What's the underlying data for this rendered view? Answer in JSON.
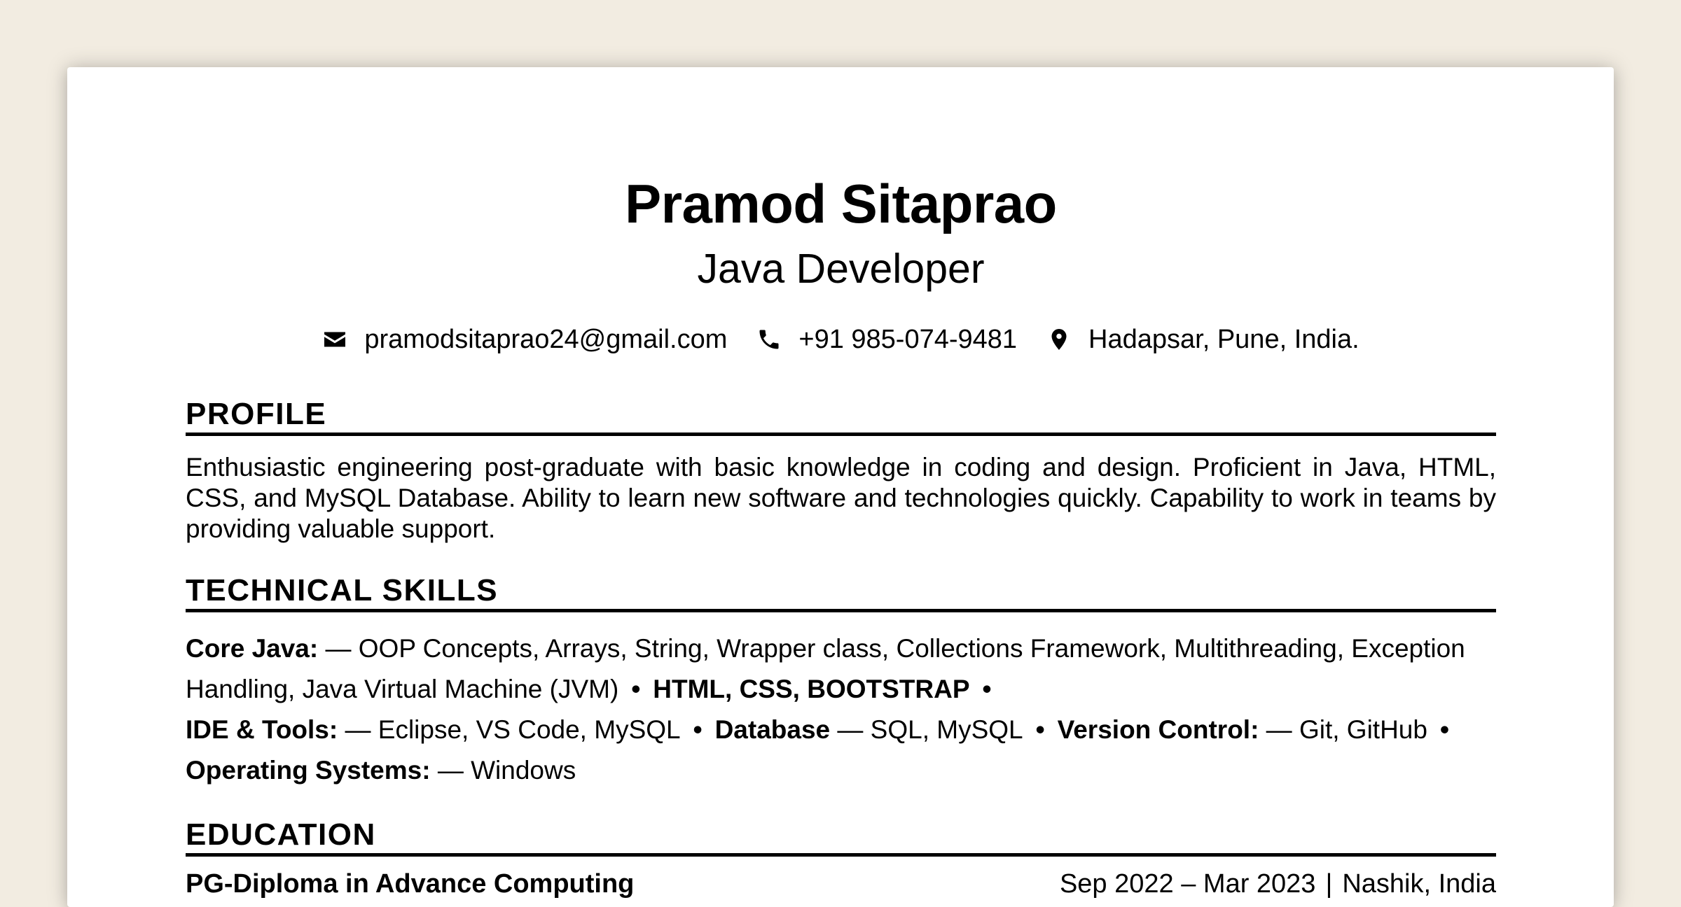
{
  "header": {
    "name": "Pramod Sitaprao",
    "title": "Java Developer"
  },
  "contact": [
    {
      "icon": "envelope-icon",
      "text": "pramodsitaprao24@gmail.com"
    },
    {
      "icon": "phone-icon",
      "text": "+91 985-074-9481"
    },
    {
      "icon": "map-pin-icon",
      "text": "Hadapsar, Pune, India."
    }
  ],
  "sections": {
    "profile": {
      "heading": "PROFILE",
      "text": "Enthusiastic engineering post-graduate with basic knowledge in coding and design. Proficient in Java, HTML, CSS, and MySQL Database. Ability to learn new software and technologies quickly. Capability to work in teams by providing valuable support."
    },
    "skills": {
      "heading": "TECHNICAL SKILLS",
      "items": [
        {
          "label": "Core Java:",
          "value": " — OOP Concepts, Arrays, String, Wrapper class, Collections Framework, Multithreading, Exception Handling, Java Virtual Machine (JVM)"
        },
        {
          "label": "HTML, CSS, BOOTSTRAP",
          "value": ""
        },
        {
          "label": "IDE & Tools:",
          "value": " — Eclipse, VS Code, MySQL"
        },
        {
          "label": "Database",
          "value": " — SQL, MySQL"
        },
        {
          "label": "Version Control:",
          "value": " — Git, GitHub"
        },
        {
          "label": "Operating Systems:",
          "value": " — Windows"
        }
      ]
    },
    "education": {
      "heading": "EDUCATION",
      "degree": "PG-Diploma in Advance Computing",
      "dates": "Sep 2022 – Mar 2023",
      "location": "Nashik, India"
    }
  },
  "colors": {
    "background": "#f2ece1",
    "page": "#ffffff",
    "text": "#000000"
  }
}
